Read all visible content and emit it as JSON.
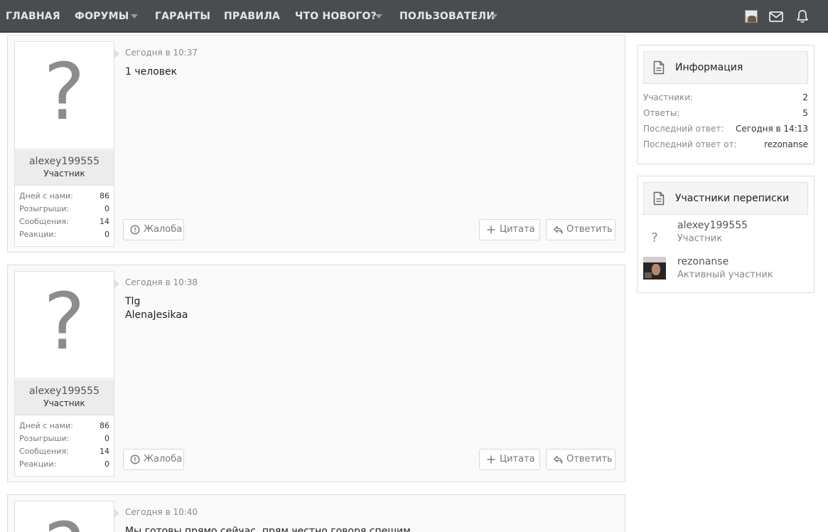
{
  "nav": {
    "items": [
      {
        "label": "ГЛАВНАЯ",
        "has_dropdown": false
      },
      {
        "label": "ФОРУМЫ",
        "has_dropdown": true
      },
      {
        "label": "ГАРАНТЫ",
        "has_dropdown": false
      },
      {
        "label": "ПРАВИЛА",
        "has_dropdown": false
      },
      {
        "label": "ЧТО НОВОГО?",
        "has_dropdown": true
      },
      {
        "label": "ПОЛЬЗОВАТЕЛИ",
        "has_dropdown": true
      }
    ],
    "icons": [
      "user-avatar-icon",
      "envelope-icon",
      "bell-icon"
    ]
  },
  "posts": [
    {
      "avatar_glyph": "?",
      "username": "alexey199555",
      "user_title": "Участник",
      "stats": [
        {
          "label": "Дней с нами:",
          "value": "86"
        },
        {
          "label": "Розыгрыши:",
          "value": "0"
        },
        {
          "label": "Сообщения:",
          "value": "14"
        },
        {
          "label": "Реакции:",
          "value": "0"
        }
      ],
      "date": "Сегодня в 10:37",
      "lines": [
        "1 человек"
      ],
      "report_label": "Жалоба",
      "quote_label": "Цитата",
      "reply_label": "Ответить"
    },
    {
      "avatar_glyph": "?",
      "username": "alexey199555",
      "user_title": "Участник",
      "stats": [
        {
          "label": "Дней с нами:",
          "value": "86"
        },
        {
          "label": "Розыгрыши:",
          "value": "0"
        },
        {
          "label": "Сообщения:",
          "value": "14"
        },
        {
          "label": "Реакции:",
          "value": "0"
        }
      ],
      "date": "Сегодня в 10:38",
      "lines": [
        "Tlg",
        "AlenaJesikaa"
      ],
      "report_label": "Жалоба",
      "quote_label": "Цитата",
      "reply_label": "Ответить"
    },
    {
      "avatar_glyph": "?",
      "date": "Сегодня в 10:40",
      "lines": [
        "Мы готовы прямо сейчас, прям честно говоря спешим"
      ]
    }
  ],
  "sidebar": {
    "info": {
      "title": "Информация",
      "rows": [
        {
          "label": "Участники:",
          "value": "2"
        },
        {
          "label": "Ответы:",
          "value": "5"
        },
        {
          "label": "Последний ответ:",
          "value": "Сегодня в 14:13"
        },
        {
          "label": "Последний ответ от:",
          "value": "rezonanse"
        }
      ]
    },
    "participants": {
      "title": "Участники переписки",
      "members": [
        {
          "name": "alexey199555",
          "title": "Участник",
          "avatar": "?"
        },
        {
          "name": "rezonanse",
          "title": "Активный участник",
          "avatar": ""
        }
      ]
    }
  },
  "colors": {
    "navbar": "#4a4d50",
    "post_bg": "#fafafa",
    "border": "#dcdcdc"
  }
}
